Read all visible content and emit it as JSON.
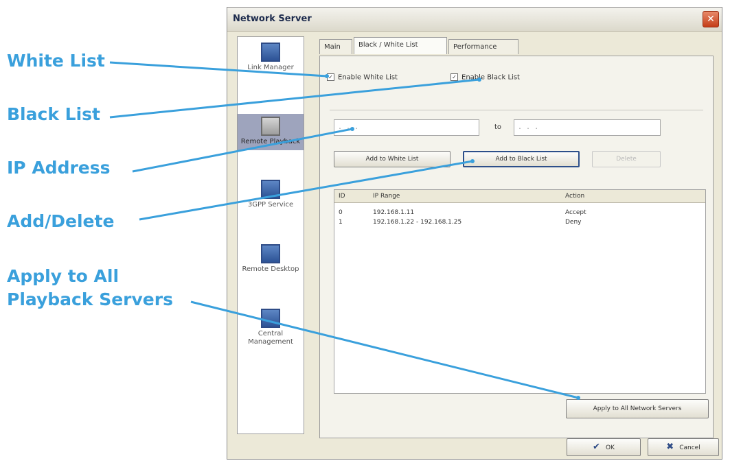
{
  "callouts": {
    "white_list": "White List",
    "black_list": "Black List",
    "ip_address": "IP Address",
    "add_delete": "Add/Delete",
    "apply_all_line1": "Apply to All",
    "apply_all_line2": "Playback Servers"
  },
  "window": {
    "title": "Network Server",
    "close_glyph": "✕"
  },
  "sidebar": {
    "items": [
      {
        "label": "Link Manager"
      },
      {
        "label": "Remote Playback"
      },
      {
        "label": "3GPP Service"
      },
      {
        "label": "Remote Desktop"
      },
      {
        "label": "Central Management"
      }
    ]
  },
  "tabs": {
    "main": "Main",
    "black_white_list": "Black / White List",
    "performance": "Performance"
  },
  "options": {
    "enable_white_list": "Enable White List",
    "enable_black_list": "Enable Black List",
    "check_glyph": "✓"
  },
  "ip": {
    "from_placeholder": ". . .",
    "to_label": "to",
    "to_placeholder": ". . ."
  },
  "buttons": {
    "add_white": "Add to White List",
    "add_black": "Add to Black List",
    "delete": "Delete",
    "apply_all": "Apply to All Network Servers",
    "ok": "OK",
    "cancel": "Cancel",
    "ok_glyph": "✔",
    "cancel_glyph": "✖"
  },
  "list": {
    "headers": {
      "id": "ID",
      "ip_range": "IP Range",
      "action": "Action"
    },
    "rows": [
      {
        "id": "0",
        "ip_range": "192.168.1.11",
        "action": "Accept"
      },
      {
        "id": "1",
        "ip_range": "192.168.1.22 - 192.168.1.25",
        "action": "Deny"
      }
    ]
  },
  "colors": {
    "callout": "#3aa0dc",
    "accent": "#2d4f8a"
  },
  "icons": {
    "link_manager": "computer-icon",
    "remote_playback": "playback-icon",
    "gpp_service": "phone-icon",
    "remote_desktop": "desktop-icon",
    "central_management": "management-icon"
  }
}
